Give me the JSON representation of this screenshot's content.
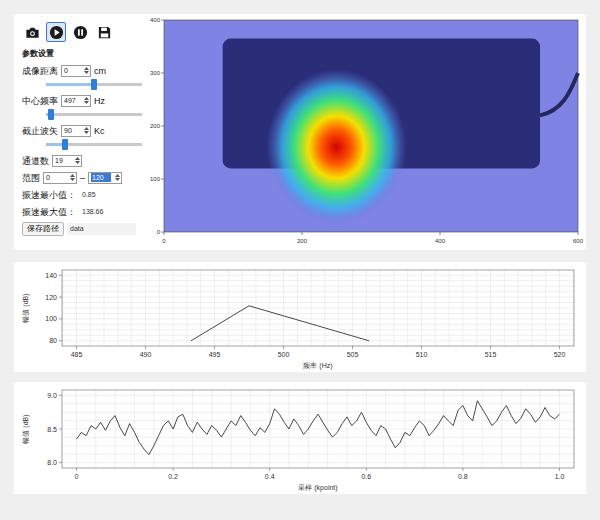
{
  "toolbar": [
    {
      "kind": "camera",
      "selected": false
    },
    {
      "kind": "play",
      "selected": true
    },
    {
      "kind": "pause",
      "selected": false
    },
    {
      "kind": "save",
      "selected": false
    }
  ],
  "settings": {
    "title": "参数设置",
    "rows": [
      {
        "kind": "spin-slider",
        "label": "成像距离",
        "value": "0",
        "unit": "cm",
        "level": 0.5
      },
      {
        "kind": "spin-slider",
        "label": "中心频率",
        "value": "497",
        "unit": "Hz",
        "level": 0.05
      },
      {
        "kind": "spin-slider",
        "label": "截止波矢",
        "value": "90",
        "unit": "Kc",
        "level": 0.2
      },
      {
        "kind": "spin",
        "label": "通道数",
        "value": "19"
      },
      {
        "kind": "range",
        "label": "范围",
        "from": "0",
        "separator": "–",
        "to": "120",
        "to_selected": true
      },
      {
        "kind": "readout",
        "label": "振速最小值：",
        "value": "0.85"
      },
      {
        "kind": "readout",
        "label": "振速最大值：",
        "value": "138.66"
      },
      {
        "kind": "path",
        "button": "保存路径",
        "value": "data"
      }
    ]
  },
  "heatmap": {
    "x_ticks": [
      "0",
      "200",
      "400",
      "600"
    ],
    "y_ticks": [
      "0",
      "100",
      "200",
      "300",
      "400"
    ]
  },
  "spectrum": {
    "y_label": "幅值 (dB)",
    "x_label": "频率 (Hz)",
    "x_ticks": [
      "485",
      "490",
      "495",
      "500",
      "505",
      "510",
      "515",
      "520"
    ],
    "y_ticks": [
      "80",
      "100",
      "120",
      "140"
    ],
    "series": {
      "x": [
        493.3,
        497.5,
        506.2
      ],
      "y": [
        80,
        112,
        80
      ]
    }
  },
  "waveform": {
    "y_label": "幅值 (dB)",
    "x_label": "采样 (kpoint)",
    "x_ticks": [
      "0",
      "0.2",
      "0.4",
      "0.6",
      "0.8",
      "1.0"
    ],
    "y_ticks": [
      "8.0",
      "8.5",
      "9.0"
    ],
    "series": {
      "y": [
        8.35,
        8.45,
        8.4,
        8.55,
        8.5,
        8.6,
        8.48,
        8.62,
        8.7,
        8.52,
        8.4,
        8.58,
        8.45,
        8.3,
        8.2,
        8.12,
        8.25,
        8.4,
        8.55,
        8.62,
        8.5,
        8.68,
        8.72,
        8.55,
        8.45,
        8.6,
        8.5,
        8.42,
        8.55,
        8.48,
        8.38,
        8.5,
        8.62,
        8.55,
        8.7,
        8.6,
        8.48,
        8.4,
        8.52,
        8.45,
        8.58,
        8.8,
        8.72,
        8.6,
        8.5,
        8.65,
        8.55,
        8.42,
        8.5,
        8.62,
        8.72,
        8.6,
        8.48,
        8.38,
        8.45,
        8.58,
        8.68,
        8.55,
        8.62,
        8.75,
        8.6,
        8.48,
        8.4,
        8.55,
        8.5,
        8.35,
        8.22,
        8.3,
        8.45,
        8.4,
        8.52,
        8.62,
        8.55,
        8.4,
        8.48,
        8.58,
        8.7,
        8.62,
        8.55,
        8.78,
        8.85,
        8.7,
        8.62,
        8.92,
        8.8,
        8.68,
        8.55,
        8.62,
        8.75,
        8.85,
        8.7,
        8.58,
        8.66,
        8.8,
        8.72,
        8.6,
        8.68,
        8.82,
        8.7,
        8.65,
        8.72
      ]
    }
  }
}
